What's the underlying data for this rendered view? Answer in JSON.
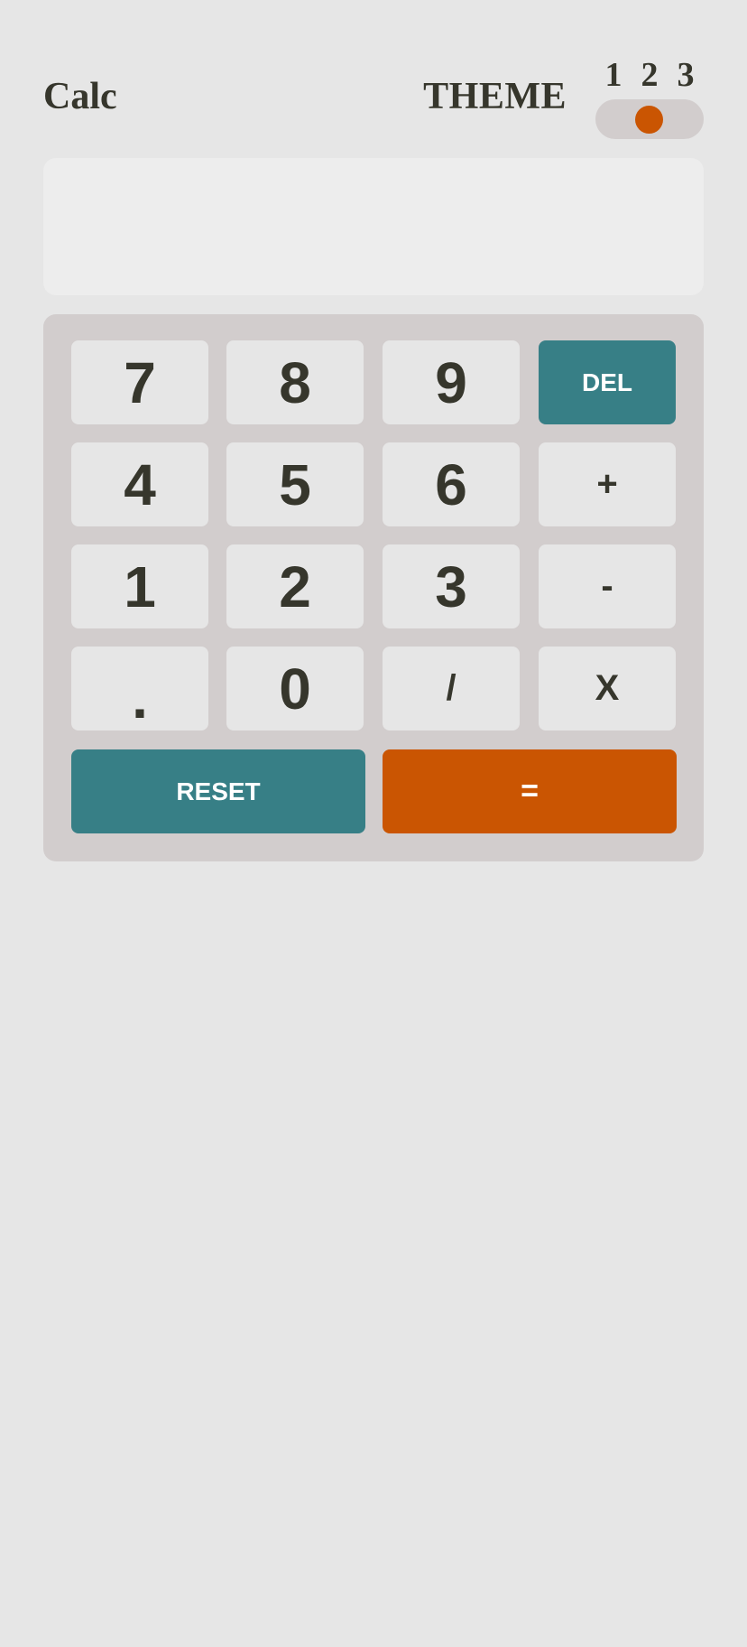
{
  "header": {
    "brand": "Calc",
    "theme_label": "THEME",
    "theme_options": [
      "1",
      "2",
      "3"
    ],
    "selected_theme": "2"
  },
  "display": {
    "value": ""
  },
  "keypad": {
    "rows": [
      [
        "7",
        "8",
        "9",
        "DEL"
      ],
      [
        "4",
        "5",
        "6",
        "+"
      ],
      [
        "1",
        "2",
        "3",
        "-"
      ],
      [
        ".",
        "0",
        "/",
        "X"
      ]
    ],
    "reset_label": "RESET",
    "equals_label": "="
  },
  "colors": {
    "background": "#e6e6e6",
    "keypad_background": "#d2cdcd",
    "screen_background": "#ededed",
    "key_background": "#e6e6e6",
    "key_text": "#36362c",
    "accent": "#377f86",
    "equals": "#ca5502",
    "toggle_knob": "#ca5502"
  }
}
